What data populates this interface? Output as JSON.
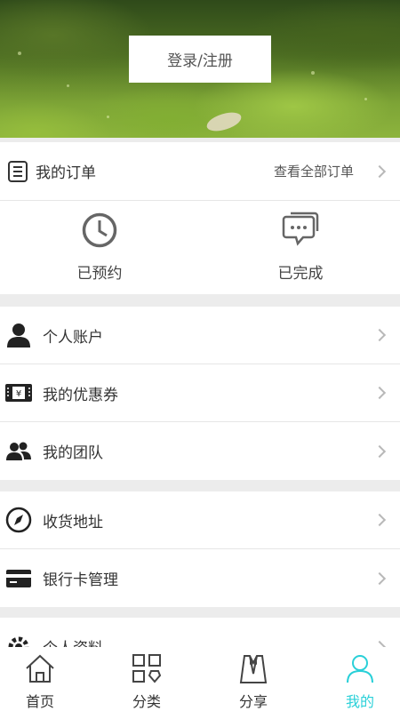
{
  "header": {
    "login_label": "登录/注册"
  },
  "orders": {
    "title": "我的订单",
    "view_all": "查看全部订单",
    "statuses": [
      {
        "label": "已预约",
        "icon": "clock-icon"
      },
      {
        "label": "已完成",
        "icon": "chat-bubble-icon"
      }
    ]
  },
  "account_menu": [
    {
      "label": "个人账户",
      "icon": "person-icon"
    },
    {
      "label": "我的优惠券",
      "icon": "coupon-icon"
    },
    {
      "label": "我的团队",
      "icon": "team-icon"
    }
  ],
  "address_menu": [
    {
      "label": "收货地址",
      "icon": "compass-icon"
    },
    {
      "label": "银行卡管理",
      "icon": "bank-card-icon"
    }
  ],
  "settings_menu": [
    {
      "label": "个人资料",
      "icon": "gear-icon"
    }
  ],
  "tabbar": {
    "active_color": "#2ad0d8",
    "tabs": [
      {
        "label": "首页",
        "icon": "home-icon"
      },
      {
        "label": "分类",
        "icon": "grid-icon"
      },
      {
        "label": "分享",
        "icon": "share-tuxedo-icon"
      },
      {
        "label": "我的",
        "icon": "user-icon",
        "active": true
      }
    ]
  }
}
